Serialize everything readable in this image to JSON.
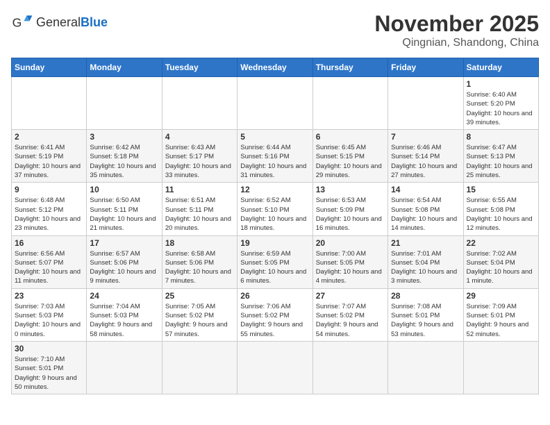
{
  "header": {
    "logo_general": "General",
    "logo_blue": "Blue",
    "month": "November 2025",
    "location": "Qingnian, Shandong, China"
  },
  "weekdays": [
    "Sunday",
    "Monday",
    "Tuesday",
    "Wednesday",
    "Thursday",
    "Friday",
    "Saturday"
  ],
  "weeks": [
    [
      {
        "day": "",
        "info": ""
      },
      {
        "day": "",
        "info": ""
      },
      {
        "day": "",
        "info": ""
      },
      {
        "day": "",
        "info": ""
      },
      {
        "day": "",
        "info": ""
      },
      {
        "day": "",
        "info": ""
      },
      {
        "day": "1",
        "info": "Sunrise: 6:40 AM\nSunset: 5:20 PM\nDaylight: 10 hours and 39 minutes."
      }
    ],
    [
      {
        "day": "2",
        "info": "Sunrise: 6:41 AM\nSunset: 5:19 PM\nDaylight: 10 hours and 37 minutes."
      },
      {
        "day": "3",
        "info": "Sunrise: 6:42 AM\nSunset: 5:18 PM\nDaylight: 10 hours and 35 minutes."
      },
      {
        "day": "4",
        "info": "Sunrise: 6:43 AM\nSunset: 5:17 PM\nDaylight: 10 hours and 33 minutes."
      },
      {
        "day": "5",
        "info": "Sunrise: 6:44 AM\nSunset: 5:16 PM\nDaylight: 10 hours and 31 minutes."
      },
      {
        "day": "6",
        "info": "Sunrise: 6:45 AM\nSunset: 5:15 PM\nDaylight: 10 hours and 29 minutes."
      },
      {
        "day": "7",
        "info": "Sunrise: 6:46 AM\nSunset: 5:14 PM\nDaylight: 10 hours and 27 minutes."
      },
      {
        "day": "8",
        "info": "Sunrise: 6:47 AM\nSunset: 5:13 PM\nDaylight: 10 hours and 25 minutes."
      }
    ],
    [
      {
        "day": "9",
        "info": "Sunrise: 6:48 AM\nSunset: 5:12 PM\nDaylight: 10 hours and 23 minutes."
      },
      {
        "day": "10",
        "info": "Sunrise: 6:50 AM\nSunset: 5:11 PM\nDaylight: 10 hours and 21 minutes."
      },
      {
        "day": "11",
        "info": "Sunrise: 6:51 AM\nSunset: 5:11 PM\nDaylight: 10 hours and 20 minutes."
      },
      {
        "day": "12",
        "info": "Sunrise: 6:52 AM\nSunset: 5:10 PM\nDaylight: 10 hours and 18 minutes."
      },
      {
        "day": "13",
        "info": "Sunrise: 6:53 AM\nSunset: 5:09 PM\nDaylight: 10 hours and 16 minutes."
      },
      {
        "day": "14",
        "info": "Sunrise: 6:54 AM\nSunset: 5:08 PM\nDaylight: 10 hours and 14 minutes."
      },
      {
        "day": "15",
        "info": "Sunrise: 6:55 AM\nSunset: 5:08 PM\nDaylight: 10 hours and 12 minutes."
      }
    ],
    [
      {
        "day": "16",
        "info": "Sunrise: 6:56 AM\nSunset: 5:07 PM\nDaylight: 10 hours and 11 minutes."
      },
      {
        "day": "17",
        "info": "Sunrise: 6:57 AM\nSunset: 5:06 PM\nDaylight: 10 hours and 9 minutes."
      },
      {
        "day": "18",
        "info": "Sunrise: 6:58 AM\nSunset: 5:06 PM\nDaylight: 10 hours and 7 minutes."
      },
      {
        "day": "19",
        "info": "Sunrise: 6:59 AM\nSunset: 5:05 PM\nDaylight: 10 hours and 6 minutes."
      },
      {
        "day": "20",
        "info": "Sunrise: 7:00 AM\nSunset: 5:05 PM\nDaylight: 10 hours and 4 minutes."
      },
      {
        "day": "21",
        "info": "Sunrise: 7:01 AM\nSunset: 5:04 PM\nDaylight: 10 hours and 3 minutes."
      },
      {
        "day": "22",
        "info": "Sunrise: 7:02 AM\nSunset: 5:04 PM\nDaylight: 10 hours and 1 minute."
      }
    ],
    [
      {
        "day": "23",
        "info": "Sunrise: 7:03 AM\nSunset: 5:03 PM\nDaylight: 10 hours and 0 minutes."
      },
      {
        "day": "24",
        "info": "Sunrise: 7:04 AM\nSunset: 5:03 PM\nDaylight: 9 hours and 58 minutes."
      },
      {
        "day": "25",
        "info": "Sunrise: 7:05 AM\nSunset: 5:02 PM\nDaylight: 9 hours and 57 minutes."
      },
      {
        "day": "26",
        "info": "Sunrise: 7:06 AM\nSunset: 5:02 PM\nDaylight: 9 hours and 55 minutes."
      },
      {
        "day": "27",
        "info": "Sunrise: 7:07 AM\nSunset: 5:02 PM\nDaylight: 9 hours and 54 minutes."
      },
      {
        "day": "28",
        "info": "Sunrise: 7:08 AM\nSunset: 5:01 PM\nDaylight: 9 hours and 53 minutes."
      },
      {
        "day": "29",
        "info": "Sunrise: 7:09 AM\nSunset: 5:01 PM\nDaylight: 9 hours and 52 minutes."
      }
    ],
    [
      {
        "day": "30",
        "info": "Sunrise: 7:10 AM\nSunset: 5:01 PM\nDaylight: 9 hours and 50 minutes."
      },
      {
        "day": "",
        "info": ""
      },
      {
        "day": "",
        "info": ""
      },
      {
        "day": "",
        "info": ""
      },
      {
        "day": "",
        "info": ""
      },
      {
        "day": "",
        "info": ""
      },
      {
        "day": "",
        "info": ""
      }
    ]
  ]
}
